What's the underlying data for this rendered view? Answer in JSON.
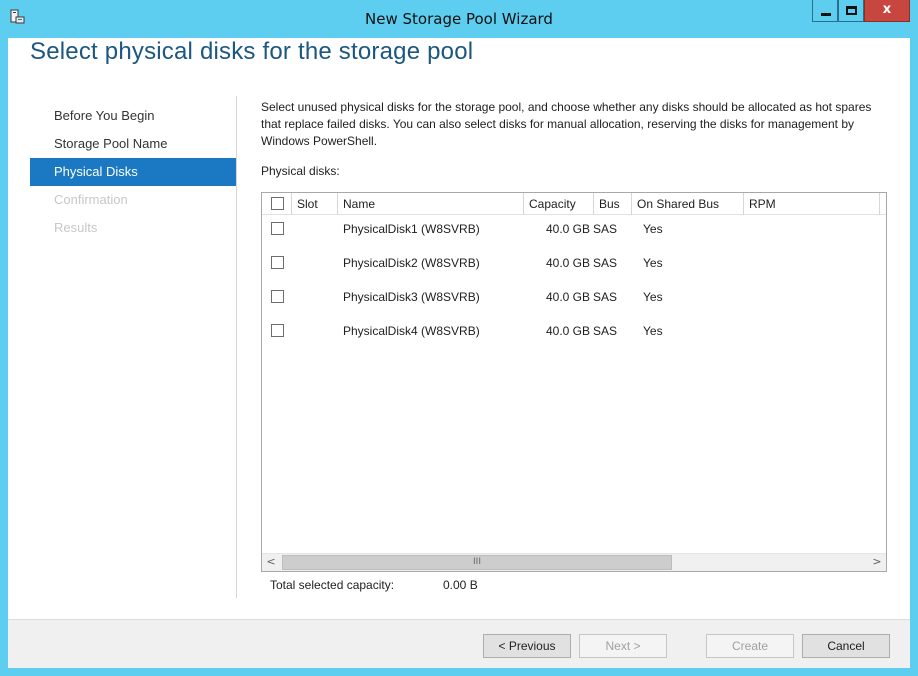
{
  "window": {
    "title": "New Storage Pool Wizard",
    "icon": "storage-wizard-icon",
    "accent_color": "#5dcdf0",
    "close_color": "#c7463f"
  },
  "page": {
    "heading": "Select physical disks for the storage pool"
  },
  "nav": {
    "items": [
      {
        "label": "Before You Begin",
        "state": "normal"
      },
      {
        "label": "Storage Pool Name",
        "state": "normal"
      },
      {
        "label": "Physical Disks",
        "state": "active"
      },
      {
        "label": "Confirmation",
        "state": "disabled"
      },
      {
        "label": "Results",
        "state": "disabled"
      }
    ],
    "active_color": "#1a79c2"
  },
  "content": {
    "description": "Select unused physical disks for the storage pool, and choose whether any disks should be allocated as hot spares that replace failed disks. You can also select disks for manual allocation, reserving the disks for management by Windows PowerShell.",
    "list_label": "Physical disks:",
    "columns": [
      "Slot",
      "Name",
      "Capacity",
      "Bus",
      "On Shared Bus",
      "RPM"
    ],
    "disks": [
      {
        "slot": "",
        "name": "PhysicalDisk1 (W8SVRB)",
        "capacity": "40.0 GB",
        "bus": "SAS",
        "shared": "Yes",
        "rpm": ""
      },
      {
        "slot": "",
        "name": "PhysicalDisk2 (W8SVRB)",
        "capacity": "40.0 GB",
        "bus": "SAS",
        "shared": "Yes",
        "rpm": ""
      },
      {
        "slot": "",
        "name": "PhysicalDisk3 (W8SVRB)",
        "capacity": "40.0 GB",
        "bus": "SAS",
        "shared": "Yes",
        "rpm": ""
      },
      {
        "slot": "",
        "name": "PhysicalDisk4 (W8SVRB)",
        "capacity": "40.0 GB",
        "bus": "SAS",
        "shared": "Yes",
        "rpm": ""
      }
    ],
    "scroll": {
      "left_arrow": "<",
      "right_arrow": ">",
      "thumb_grip": "III"
    },
    "total_label": "Total selected capacity:",
    "total_value": "0.00 B"
  },
  "buttons": {
    "previous": "< Previous",
    "next": "Next >",
    "create": "Create",
    "cancel": "Cancel"
  }
}
